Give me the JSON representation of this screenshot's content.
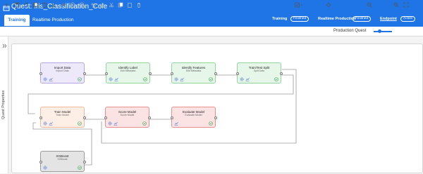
{
  "header": {
    "title": "Quest: Iris_Classification_Cole",
    "tabs": [
      {
        "label": "Training"
      },
      {
        "label": "Realtime Production"
      }
    ],
    "training_status_label": "Training",
    "training_status": "Finished",
    "realtime_status_label": "Realtime Production",
    "realtime_status": "Finished",
    "endpoint_label": "Endpoint",
    "endpoint_status": "Active"
  },
  "toolbar": {
    "production_quest_label": "Production Quest",
    "icons": [
      "back-icon",
      "save-icon",
      "refresh-icon",
      "copy-icon",
      "paste-icon",
      "export-icon",
      "run-icon",
      "stop-icon",
      "stop-all-icon",
      "undo-icon",
      "redo-icon",
      "cut-icon",
      "copy-node-icon",
      "paste-node-icon",
      "delete-icon"
    ]
  },
  "sidebar": {
    "label": "Quest Properties"
  },
  "colors": {
    "brand": "#1f75e5",
    "purple": "#eee8fb",
    "green": "#e6f6e8",
    "orange": "#fdeee6",
    "red": "#fbe3e3",
    "gray": "#e4e4e4",
    "check": "#3ca85a"
  },
  "nodes": [
    {
      "title": "Import Data",
      "subtitle": "Import Data",
      "color": "purple",
      "icons": [
        "settings-icon",
        "chart-icon"
      ]
    },
    {
      "title": "Identify Label",
      "subtitle": "Edit Metadata",
      "color": "green",
      "icons": [
        "settings-icon",
        "chart-icon"
      ]
    },
    {
      "title": "Identify Features",
      "subtitle": "Edit Metadata",
      "color": "green",
      "icons": [
        "settings-icon",
        "chart-icon"
      ]
    },
    {
      "title": "Train/Test Split",
      "subtitle": "Split Data",
      "color": "green",
      "icons": [
        "settings-icon",
        "chart-icon"
      ]
    },
    {
      "title": "Train Model",
      "subtitle": "Train Model",
      "color": "orange",
      "icons": [
        "settings-icon",
        "chart-icon"
      ]
    },
    {
      "title": "Score Model",
      "subtitle": "Score Model",
      "color": "red",
      "icons": [
        "settings-icon",
        "chart-icon"
      ]
    },
    {
      "title": "Evaluate Model",
      "subtitle": "Evaluate Model",
      "color": "red",
      "icons": [
        "chart-icon"
      ]
    },
    {
      "title": "XGBoost",
      "subtitle": "XGBoost",
      "color": "gray",
      "icons": [
        "settings-icon"
      ]
    }
  ]
}
